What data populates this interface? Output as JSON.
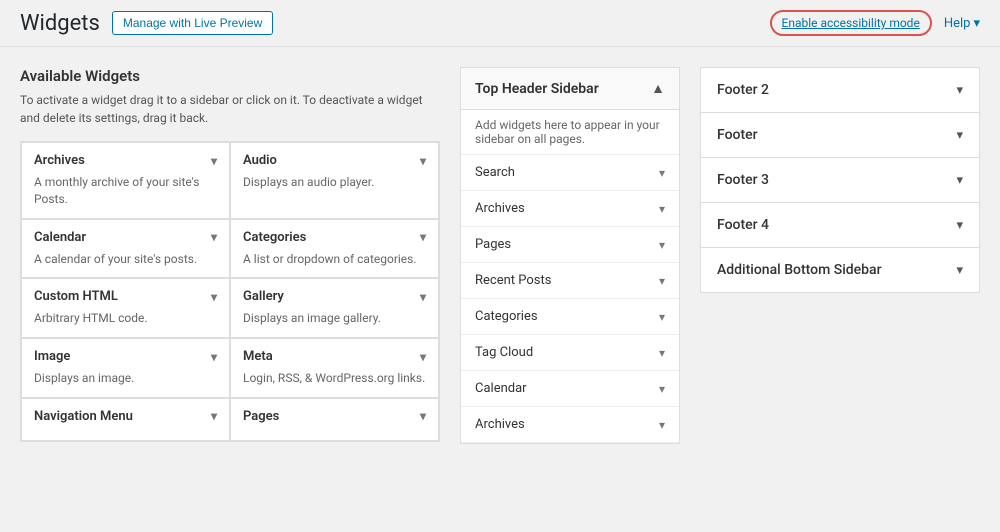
{
  "header": {
    "title": "Widgets",
    "live_preview_btn": "Manage with Live Preview",
    "accessibility_btn": "Enable accessibility mode",
    "help_label": "Help",
    "chevron_down": "▾"
  },
  "available_widgets": {
    "title": "Available Widgets",
    "description": "To activate a widget drag it to a sidebar or click on it. To deactivate a widget and delete its settings, drag it back.",
    "widgets": [
      {
        "name": "Archives",
        "desc": "A monthly archive of your site's Posts."
      },
      {
        "name": "Audio",
        "desc": "Displays an audio player."
      },
      {
        "name": "Calendar",
        "desc": "A calendar of your site's posts."
      },
      {
        "name": "Categories",
        "desc": "A list or dropdown of categories."
      },
      {
        "name": "Custom HTML",
        "desc": "Arbitrary HTML code."
      },
      {
        "name": "Gallery",
        "desc": "Displays an image gallery."
      },
      {
        "name": "Image",
        "desc": "Displays an image."
      },
      {
        "name": "Meta",
        "desc": "Login, RSS, & WordPress.org links."
      },
      {
        "name": "Navigation Menu",
        "desc": ""
      },
      {
        "name": "Pages",
        "desc": ""
      }
    ]
  },
  "top_header_sidebar": {
    "title": "Top Header Sidebar",
    "description": "Add widgets here to appear in your sidebar on all pages.",
    "widgets": [
      "Search",
      "Archives",
      "Pages",
      "Recent Posts",
      "Categories",
      "Tag Cloud",
      "Calendar",
      "Archives"
    ]
  },
  "right_sidebars": [
    {
      "label": "Footer 2"
    },
    {
      "label": "Footer 3"
    },
    {
      "label": "Footer 4"
    },
    {
      "label": "Additional Bottom Sidebar"
    }
  ],
  "footer_panel": {
    "label": "Footer"
  }
}
